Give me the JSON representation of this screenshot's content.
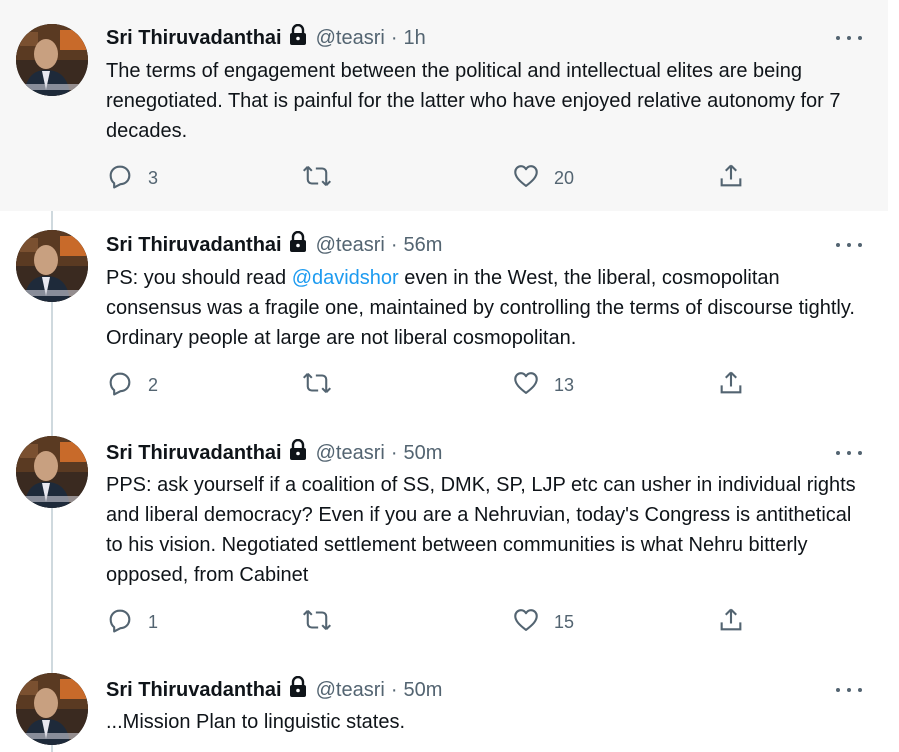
{
  "author": {
    "name": "Sri Thiruvadanthai",
    "handle": "@teasri",
    "protected_icon": "lock-icon"
  },
  "tweets": [
    {
      "time": "1h",
      "text": "The terms of engagement between the political and intellectual elites are being renegotiated. That is painful for the latter who have enjoyed relative autonomy for 7 decades.",
      "replies": "3",
      "retweets": "",
      "likes": "20"
    },
    {
      "time": "56m",
      "text_before": "PS: you should read ",
      "mention": "@davidshor",
      "text_after": " even in the West, the liberal, cosmopolitan consensus was a fragile one, maintained by controlling the terms of discourse tightly. Ordinary people at large are not liberal cosmopolitan.",
      "replies": "2",
      "retweets": "",
      "likes": "13"
    },
    {
      "time": "50m",
      "text": "PPS: ask yourself if a coalition of SS, DMK, SP, LJP etc can usher in individual rights and liberal democracy? Even if you are a Nehruvian, today's Congress is antithetical to his vision. Negotiated settlement between communities is what Nehru bitterly opposed, from Cabinet",
      "replies": "1",
      "retweets": "",
      "likes": "15"
    },
    {
      "time": "50m",
      "text": "...Mission Plan to linguistic states."
    }
  ],
  "separator": "·",
  "icons": {
    "reply": "reply-icon",
    "retweet": "retweet-icon",
    "like": "heart-icon",
    "share": "share-icon",
    "more": "more-icon"
  },
  "colors": {
    "highlight_bg": "#f7f7f7",
    "link": "#1d9bf0",
    "secondary": "#536471",
    "thread_line": "#cfd9de"
  }
}
